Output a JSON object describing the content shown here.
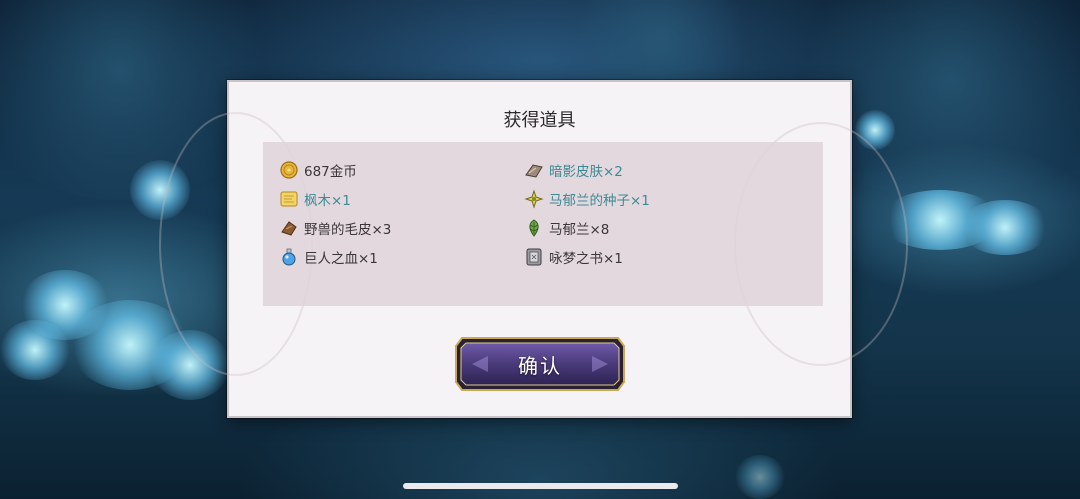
{
  "dialog": {
    "title": "获得道具",
    "confirm_label": "确认"
  },
  "items": [
    {
      "label": "687金币",
      "icon": "gold-coin-icon",
      "rarity": "normal"
    },
    {
      "label": "暗影皮肤×2",
      "icon": "shadow-hide-icon",
      "rarity": "rare"
    },
    {
      "label": "枫木×1",
      "icon": "maple-wood-icon",
      "rarity": "rare"
    },
    {
      "label": "马郁兰的种子×1",
      "icon": "marjoram-seed-icon",
      "rarity": "rare"
    },
    {
      "label": "野兽的毛皮×3",
      "icon": "beast-fur-icon",
      "rarity": "normal"
    },
    {
      "label": "马郁兰×8",
      "icon": "marjoram-leaf-icon",
      "rarity": "normal"
    },
    {
      "label": "巨人之血×1",
      "icon": "giant-blood-potion-icon",
      "rarity": "normal"
    },
    {
      "label": "咏梦之书×1",
      "icon": "dream-book-icon",
      "rarity": "normal"
    }
  ],
  "colors": {
    "normal_text": "#3a3639",
    "rare_text": "#3e8a93",
    "button_fill": "#4a3a7a",
    "button_frame": "#c8a85a"
  }
}
